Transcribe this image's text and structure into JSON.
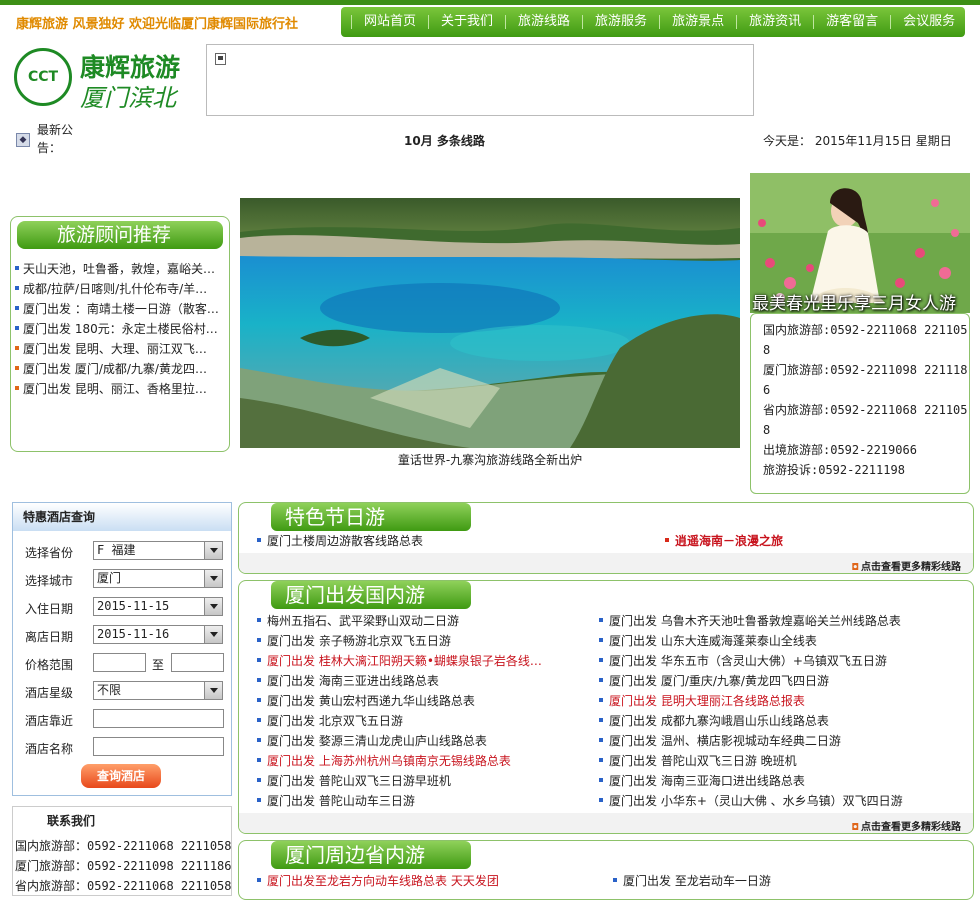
{
  "header": {
    "slogan": "康辉旅游 风景独好 欢迎光临厦门康辉国际旅行社",
    "nav": [
      "网站首页",
      "关于我们",
      "旅游线路",
      "旅游服务",
      "旅游景点",
      "旅游资讯",
      "游客留言",
      "会议服务"
    ]
  },
  "logo": {
    "emblem": "CCT",
    "line1": "康辉旅游",
    "line2": "厦门滨北"
  },
  "notice": {
    "label": "最新公告：",
    "text": "10月 多条线路",
    "date": "今天是： 2015年11月15日 星期日"
  },
  "advisor": {
    "title": "旅游顾问推荐",
    "items": [
      {
        "text": "天山天池，吐鲁番，敦煌，嘉峪关…",
        "color": "blue"
      },
      {
        "text": "成都/拉萨/日喀则/扎什伦布寺/羊…",
        "color": "blue"
      },
      {
        "text": "厦门出发 ：南靖土楼一日游（散客…",
        "color": "blue"
      },
      {
        "text": "厦门出发 180元：永定土楼民俗村…",
        "color": "blue"
      },
      {
        "text": "厦门出发  昆明、大理、丽江双飞…",
        "color": "orange"
      },
      {
        "text": "厦门出发  厦门/成都/九寨/黄龙四…",
        "color": "orange"
      },
      {
        "text": "厦门出发  昆明、丽江、香格里拉…",
        "color": "orange"
      }
    ]
  },
  "hero": {
    "caption": "童话世界-九寨沟旅游线路全新出炉"
  },
  "banner": {
    "caption": "最美春光里乐享三月女人游"
  },
  "contact_right": [
    "国内旅游部:0592-2211068 2211058",
    "厦门旅游部:0592-2211098 2211186",
    "省内旅游部:0592-2211068 2211058",
    "出境旅游部:0592-2219066",
    "旅游投诉:0592-2211198"
  ],
  "hotel": {
    "title": "特惠酒店查询",
    "province_label": "选择省份",
    "province_value": "F 福建",
    "city_label": "选择城市",
    "city_value": "厦门",
    "checkin_label": "入住日期",
    "checkin_value": "2015-11-15",
    "checkout_label": "离店日期",
    "checkout_value": "2015-11-16",
    "price_label": "价格范围",
    "price_to": "至",
    "star_label": "酒店星级",
    "star_value": "不限",
    "near_label": "酒店靠近",
    "name_label": "酒店名称",
    "button": "查询酒店"
  },
  "contact_left": {
    "title": "联系我们",
    "lines": [
      "国内旅游部：0592-2211068 2211058",
      "厦门旅游部：0592-2211098 2211186",
      "省内旅游部：0592-2211068 2211058"
    ]
  },
  "festival": {
    "title": "特色节日游",
    "left": "厦门土楼周边游散客线路总表",
    "right": "逍遥海南－浪漫之旅",
    "more": "点击查看更多精彩线路"
  },
  "domestic": {
    "title": "厦门出发国内游",
    "left": [
      {
        "text": "梅州五指石、武平梁野山双动二日游",
        "style": "normal"
      },
      {
        "text": "厦门出发  亲子畅游北京双飞五日游",
        "style": "normal"
      },
      {
        "text": "厦门出发  桂林大漓江阳朔天籁•蝴蝶泉银子岩各线…",
        "style": "red"
      },
      {
        "text": "厦门出发  海南三亚进出线路总表",
        "style": "normal"
      },
      {
        "text": "厦门出发  黄山宏村西递九华山线路总表",
        "style": "normal"
      },
      {
        "text": "厦门出发  北京双飞五日游",
        "style": "normal"
      },
      {
        "text": "厦门出发  婺源三清山龙虎山庐山线路总表",
        "style": "normal"
      },
      {
        "text": "厦门出发  上海苏州杭州乌镇南京无锡线路总表",
        "style": "red"
      },
      {
        "text": "厦门出发  普陀山双飞三日游早班机",
        "style": "normal"
      },
      {
        "text": "厦门出发  普陀山动车三日游",
        "style": "normal"
      }
    ],
    "right": [
      {
        "text": "厦门出发  乌鲁木齐天池吐鲁番敦煌嘉峪关兰州线路总表",
        "style": "normal"
      },
      {
        "text": "厦门出发  山东大连威海蓬莱泰山全线表",
        "style": "normal"
      },
      {
        "text": "厦门出发  华东五市（含灵山大佛）+乌镇双飞五日游",
        "style": "normal"
      },
      {
        "text": "厦门出发  厦门/重庆/九寨/黄龙四飞四日游",
        "style": "normal"
      },
      {
        "text": "厦门出发  昆明大理丽江各线路总报表",
        "style": "red"
      },
      {
        "text": "厦门出发  成都九寨沟峨眉山乐山线路总表",
        "style": "normal"
      },
      {
        "text": "厦门出发  温州、横店影视城动车经典二日游",
        "style": "normal"
      },
      {
        "text": "厦门出发  普陀山双飞三日游 晚班机",
        "style": "normal"
      },
      {
        "text": "厦门出发  海南三亚海口进出线路总表",
        "style": "normal"
      },
      {
        "text": "厦门出发  小华东+（灵山大佛 、水乡乌镇）双飞四日游",
        "style": "normal"
      }
    ],
    "more": "点击查看更多精彩线路"
  },
  "province": {
    "title": "厦门周边省内游",
    "left": {
      "text": "厦门出发至龙岩方向动车线路总表  天天发团",
      "style": "red"
    },
    "right": {
      "text": "厦门出发  至龙岩动车一日游",
      "style": "normal"
    }
  }
}
